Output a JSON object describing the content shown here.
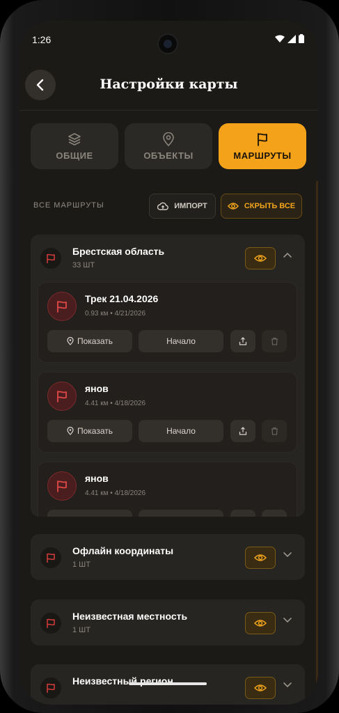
{
  "status": {
    "time": "1:26"
  },
  "header": {
    "title": "Настройки карты"
  },
  "tabs": [
    {
      "label": "ОБЩИЕ",
      "icon": "layers-icon"
    },
    {
      "label": "ОБЪЕКТЫ",
      "icon": "pin-icon"
    },
    {
      "label": "МАРШРУТЫ",
      "icon": "flag-icon",
      "active": true
    }
  ],
  "toolbar": {
    "all_label": "ВСЕ МАРШРУТЫ",
    "import_label": "ИМПОРТ",
    "hide_all_label": "СКРЫТЬ ВСЕ"
  },
  "groups": [
    {
      "title": "Брестская область",
      "count": "33 ШТ",
      "expanded": true
    },
    {
      "title": "Офлайн координаты",
      "count": "1 ШТ"
    },
    {
      "title": "Неизвестная местность",
      "count": "1 ШТ"
    },
    {
      "title": "Неизвестный регион",
      "count": ""
    }
  ],
  "routes": [
    {
      "name": "Трек 21.04.2026",
      "meta": "0.93 км • 4/21/2026",
      "show_label": "Показать",
      "start_label": "Начало"
    },
    {
      "name": "янов",
      "meta": "4.41 км • 4/18/2026",
      "show_label": "Показать",
      "start_label": "Начало"
    },
    {
      "name": "янов",
      "meta": "4.41 км • 4/18/2026"
    }
  ],
  "colors": {
    "accent": "#f4a21a",
    "flag_red": "#d63b3b",
    "bg": "#1c1a17"
  }
}
